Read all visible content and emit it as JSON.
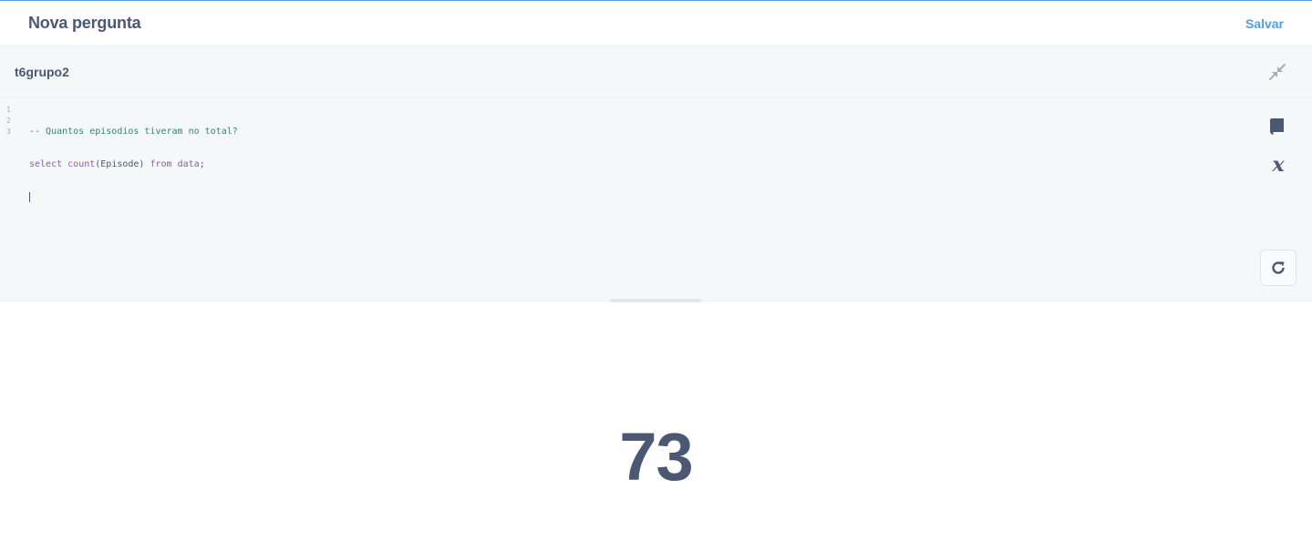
{
  "header": {
    "title": "Nova pergunta",
    "save_label": "Salvar"
  },
  "editor_bar": {
    "database_name": "t6grupo2"
  },
  "editor": {
    "line_numbers": [
      "1",
      "2",
      "3"
    ],
    "lines": [
      {
        "comment": "-- Quantos episodios tiveram no total?"
      },
      {
        "kw1": "select",
        "sp1": " ",
        "fn": "count",
        "args": "(Episode) ",
        "kw2": "from",
        "sp2": " ",
        "tbl": "data",
        "end": ";"
      },
      {}
    ]
  },
  "icons": {
    "collapse": "collapse-icon",
    "reference": "book-icon",
    "variables": "variable-x-icon",
    "run": "refresh-icon"
  },
  "result": {
    "value": "73"
  },
  "colors": {
    "accent": "#509ee3",
    "text": "#4c5773",
    "comment": "#2e8a6b",
    "keyword": "#8f5ba6",
    "editor_bg": "#f5f8f9"
  }
}
